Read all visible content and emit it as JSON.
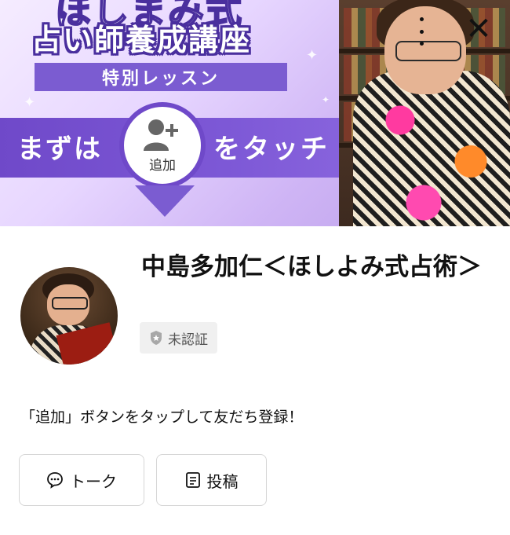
{
  "banner": {
    "title_top": "ほしまみ式",
    "title_main": "占い師養成講座",
    "special": "特別レッスン",
    "cta_left": "まずは",
    "cta_right": "をタッチ",
    "add_label": "追加"
  },
  "controls": {
    "more_icon": "more-vertical-icon",
    "close_icon": "close-icon",
    "close_glyph": "✕"
  },
  "profile": {
    "name": "中島多加仁＜ほしよみ式占術＞",
    "badge": "未認証",
    "description": "「追加」ボタンをタップして友だち登録！"
  },
  "buttons": {
    "talk": "トーク",
    "post": "投稿"
  },
  "colors": {
    "accent_purple": "#6f49c9",
    "badge_bg": "#f0f0f0"
  }
}
